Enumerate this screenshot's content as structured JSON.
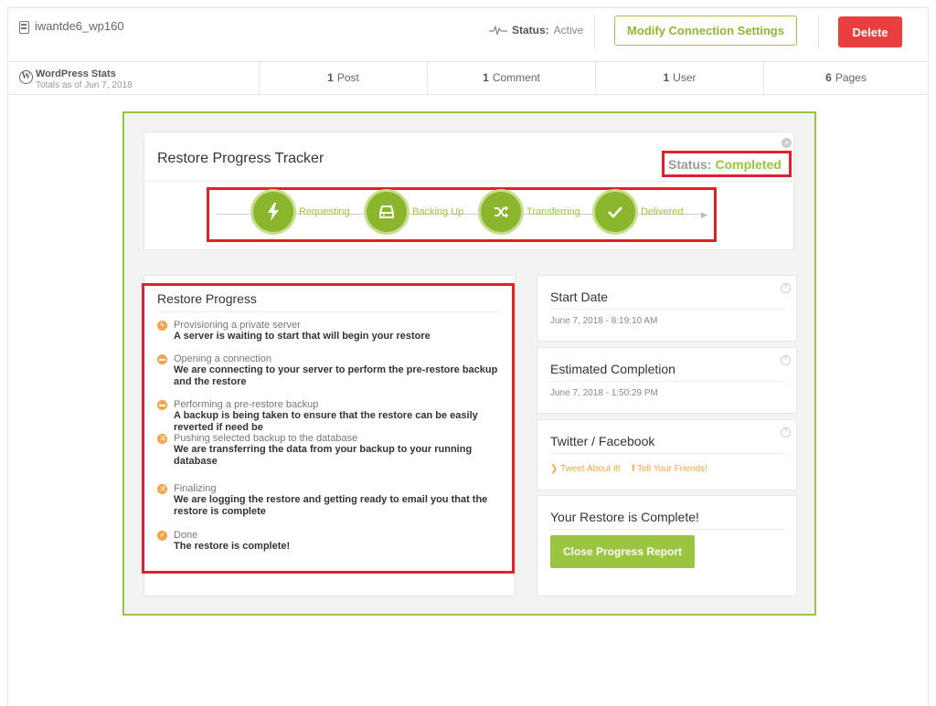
{
  "header": {
    "site_name": "iwantde6_wp160",
    "status_label": "Status:",
    "status_value": "Active",
    "modify_label": "Modify Connection Settings",
    "delete_label": "Delete"
  },
  "stats": {
    "title": "WordPress Stats",
    "subtitle": "Totals as of Jun 7, 2018",
    "posts_count": "1",
    "posts_label": "Post",
    "comments_count": "1",
    "comments_label": "Comment",
    "users_count": "1",
    "users_label": "User",
    "pages_count": "6",
    "pages_label": "Pages"
  },
  "tracker": {
    "title": "Restore Progress Tracker",
    "status_label": "Status:",
    "status_value": "Completed",
    "steps": [
      {
        "label": "Requesting",
        "icon": "lightning-icon"
      },
      {
        "label": "Backing Up",
        "icon": "drive-icon"
      },
      {
        "label": "Transferring",
        "icon": "shuffle-icon"
      },
      {
        "label": "Delivered",
        "icon": "check-icon"
      }
    ]
  },
  "restore_progress": {
    "title": "Restore Progress",
    "items": [
      {
        "head": "Provisioning a private server",
        "desc": "A server is waiting to start that will begin your restore",
        "icon": "lightning-icon"
      },
      {
        "head": "Opening a connection",
        "desc": "We are connecting to your server to perform the pre-restore backup and the restore",
        "icon": "drive-icon"
      },
      {
        "head": "Performing a pre-restore backup",
        "desc": "A backup is being taken to ensure that the restore can be easily reverted if need be",
        "icon": "drive-icon"
      },
      {
        "head": "Pushing selected backup to the database",
        "desc": "We are transferring the data from your backup to your running database",
        "icon": "shuffle-icon"
      },
      {
        "head": "Finalizing",
        "desc": "We are logging the restore and getting ready to email you that the restore is complete",
        "icon": "shuffle-icon"
      },
      {
        "head": "Done",
        "desc": "The restore is complete!",
        "icon": "check-icon"
      }
    ]
  },
  "cards": {
    "start_title": "Start Date",
    "start_value": "June 7, 2018 - 8:19:10 AM",
    "est_title": "Estimated Completion",
    "est_value": "June 7, 2018 - 1:50:29 PM",
    "social_title": "Twitter / Facebook",
    "tweet_label": "Tweet About It!",
    "tell_label": "Tell Your Friends!",
    "complete_title": "Your Restore is Complete!",
    "close_label": "Close Progress Report"
  },
  "colors": {
    "accent_green": "#9bc440",
    "delete_red": "#e9403f",
    "highlight_red": "#e1202c",
    "warning_orange": "#f0a54a"
  }
}
